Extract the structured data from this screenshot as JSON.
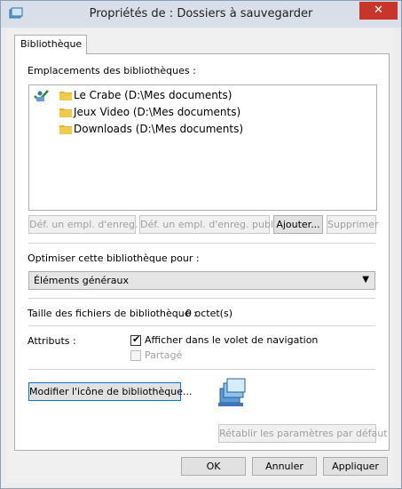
{
  "window": {
    "title": "Propriétés de : Dossiers à sauvegarder",
    "close_glyph": "✕"
  },
  "tab": {
    "label": "Bibliothèque"
  },
  "locations": {
    "label": "Emplacements des bibliothèques :",
    "items": [
      {
        "text": "Le Crabe (D:\\Mes documents)",
        "is_default_save": true
      },
      {
        "text": "Jeux Video (D:\\Mes documents)"
      },
      {
        "text": "Downloads (D:\\Mes documents)"
      }
    ],
    "buttons": {
      "set_save": "Déf. un empl. d'enreg.",
      "set_public_save": "Déf. un empl. d'enreg. public",
      "add": "Ajouter...",
      "remove": "Supprimer"
    }
  },
  "optimize": {
    "label": "Optimiser cette bibliothèque pour :",
    "selected": "Éléments généraux"
  },
  "size": {
    "label": "Taille des fichiers de bibliothèque :",
    "value": "0 octet(s)"
  },
  "attributes": {
    "label": "Attributs :",
    "show_in_nav": {
      "label": "Afficher dans le volet de navigation",
      "checked": true
    },
    "shared": {
      "label": "Partagé",
      "checked": false,
      "disabled": true
    }
  },
  "change_icon_button": "Modifier l'icône de bibliothèque...",
  "restore_defaults_button": "Rétablir les paramètres par défaut",
  "footer": {
    "ok": "OK",
    "cancel": "Annuler",
    "apply": "Appliquer"
  },
  "colors": {
    "accent": "#0078d7",
    "close": "#c7352b",
    "folder": "#e8b52a"
  }
}
